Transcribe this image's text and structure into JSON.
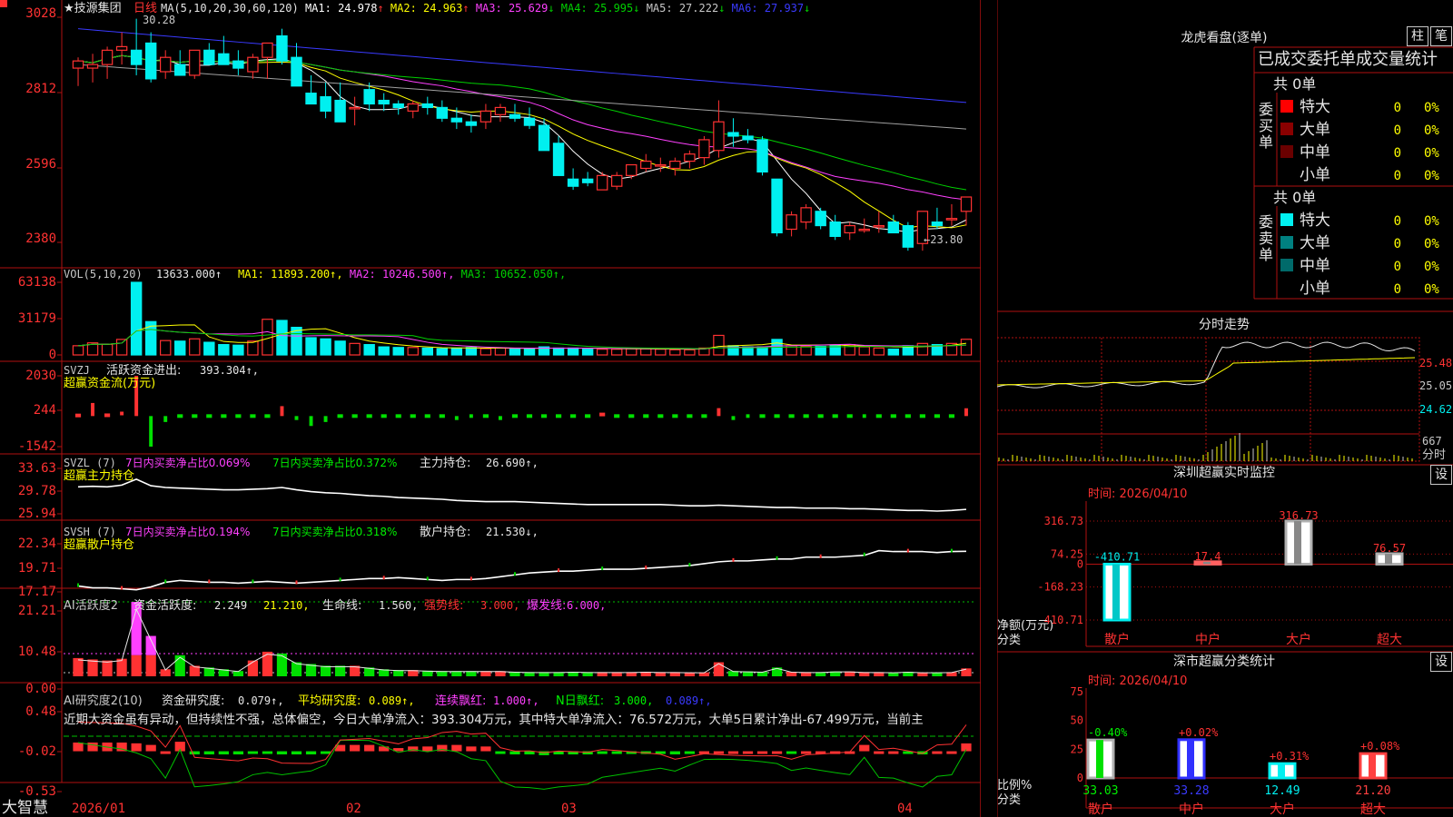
{
  "colors": {
    "up": "#ff3232",
    "down": "#00f0f0",
    "grid": "#b01010",
    "axis": "#ff3232",
    "white": "#ffffff",
    "yellow": "#ffff00",
    "magenta": "#ff40ff",
    "green": "#00d000",
    "blue": "#3a3aff",
    "gray": "#a0a0a0",
    "text": "#c8c8c8"
  },
  "main": {
    "title": "★技源集团",
    "period": "日线",
    "ma_label": "MA(5,10,20,30,60,120)",
    "ma_values": [
      {
        "label": "MA1:",
        "value": "24.978",
        "arrow": "↑",
        "color": "#ffffff"
      },
      {
        "label": "MA2:",
        "value": "24.963",
        "arrow": "↑",
        "color": "#ffff00"
      },
      {
        "label": "MA3:",
        "value": "25.629",
        "arrow": "↓",
        "color": "#ff40ff"
      },
      {
        "label": "MA4:",
        "value": "25.995",
        "arrow": "↓",
        "color": "#00d000"
      },
      {
        "label": "MA5:",
        "value": "27.222",
        "arrow": "↓",
        "color": "#c8c8c8"
      },
      {
        "label": "MA6:",
        "value": "27.937",
        "arrow": "↓",
        "color": "#3a3aff"
      }
    ],
    "y_ticks": [
      "3028",
      "2812",
      "2596",
      "2380"
    ],
    "high_label": "30.28",
    "low_label": "←23.80"
  },
  "vol": {
    "label": "VOL(5,10,20)",
    "value": "13633.000↑",
    "ma": [
      {
        "label": "MA1:",
        "value": "11893.200↑",
        "color": "#ffff00"
      },
      {
        "label": "MA2:",
        "value": "10246.500↑",
        "color": "#ff40ff"
      },
      {
        "label": "MA3:",
        "value": "10652.050↑",
        "color": "#00d000"
      }
    ],
    "y_ticks": [
      "63138",
      "31179",
      "0"
    ]
  },
  "svzj": {
    "label": "SVZJ",
    "text": "活跃资金进出:",
    "value": "393.304↑,",
    "sub": "超赢资金流(万元)",
    "y_ticks": [
      "2030",
      "244",
      "-1542"
    ]
  },
  "svzl": {
    "label": "SVZL (7)",
    "t1": "7日内买卖净占比0.069%",
    "t2": "7日内买卖净占比0.372%",
    "t3": "主力持仓:",
    "v3": "26.690↑,",
    "sub": "超赢主力持仓",
    "y_ticks": [
      "33.63",
      "29.78",
      "25.94"
    ]
  },
  "svsh": {
    "label": "SVSH (7)",
    "t1": "7日内买卖净占比0.194%",
    "t2": "7日内买卖净占比0.318%",
    "t3": "散户持仓:",
    "v3": "21.530↓,",
    "sub": "超赢散户持仓",
    "y_ticks": [
      "22.34",
      "19.71",
      "17.17"
    ]
  },
  "ai1": {
    "label": "AI活跃度2",
    "t1": "资金活跃度:",
    "v1": "2.249",
    "t2": "21.210,",
    "t3": "生命线:",
    "v3": "1.560,",
    "t4": "强势线:",
    "v4": "3.000,",
    "t5": "爆发线:",
    "v5": "6.000,",
    "y_ticks": [
      "21.21",
      "10.48",
      "0.00"
    ]
  },
  "ai2": {
    "label": "AI研究度2(10)",
    "t1": "资金研究度:",
    "v1": "0.079↑,",
    "t2": "平均研究度:",
    "v2": "0.089↑,",
    "t3": "连续飘红:",
    "v3": "1.000↑,",
    "t4": "N日飘红:",
    "v4": "3.000,",
    "v5": "0.089↑,",
    "commentary": "近期大资金虽有异动，但持续性不强，总体偏空，今日大单净流入：393.304万元，其中特大单净流入：76.572万元，大单5日累计净出-67.499万元，当前主",
    "y_ticks": [
      "0.48",
      "-0.02",
      "-0.53"
    ]
  },
  "x_axis": {
    "app": "大智慧",
    "labels": [
      "2026/01",
      "02",
      "03",
      "04"
    ]
  },
  "right": {
    "title": "龙虎看盘(逐单)",
    "btn1": "柱",
    "btn2": "笔",
    "subtitle": "已成交委托单成交量统计",
    "buy": {
      "side": "委买单",
      "total": "共 0单",
      "rows": [
        {
          "name": "特大",
          "v": "0",
          "p": "0%",
          "c": "#ff0000"
        },
        {
          "name": "大单",
          "v": "0",
          "p": "0%",
          "c": "#8a0000"
        },
        {
          "name": "中单",
          "v": "0",
          "p": "0%",
          "c": "#6a0000"
        },
        {
          "name": "小单",
          "v": "0",
          "p": "0%",
          "c": ""
        }
      ]
    },
    "sell": {
      "side": "委卖单",
      "total": "共 0单",
      "rows": [
        {
          "name": "特大",
          "v": "0",
          "p": "0%",
          "c": "#00f0f0"
        },
        {
          "name": "大单",
          "v": "0",
          "p": "0%",
          "c": "#008080"
        },
        {
          "name": "中单",
          "v": "0",
          "p": "0%",
          "c": "#006a6a"
        },
        {
          "name": "小单",
          "v": "0",
          "p": "0%",
          "c": ""
        }
      ]
    },
    "intraday": {
      "title": "分时走势",
      "ticks": [
        "25.48",
        "25.05",
        "24.62"
      ],
      "vol_tick": "667",
      "vol_label": "分时"
    },
    "monitor": {
      "title": "深圳超赢实时监控",
      "date": "时间: 2026/04/10",
      "btn": "设",
      "y_ticks": [
        "316.73",
        "74.25",
        "0",
        "-168.23",
        "-410.71"
      ],
      "ylabel1": "净额(万元)",
      "ylabel2": "分类",
      "bars": [
        {
          "cat": "散户",
          "label": "-410.71",
          "value": -410.71
        },
        {
          "cat": "中户",
          "label": "17.4",
          "value": 17.4
        },
        {
          "cat": "大户",
          "label": "316.73",
          "value": 316.73
        },
        {
          "cat": "超大",
          "label": "76.57",
          "value": 76.57
        }
      ]
    },
    "classify": {
      "title": "深市超赢分类统计",
      "date": "时间: 2026/04/10",
      "btn": "设",
      "y_ticks": [
        "75",
        "50",
        "25",
        "0"
      ],
      "ylabel1": "比例%",
      "ylabel2": "分类",
      "bars": [
        {
          "cat": "散户",
          "top": "-0.40%",
          "value": 33.03,
          "bottom": "33.03"
        },
        {
          "cat": "中户",
          "top": "+0.02%",
          "value": 33.28,
          "bottom": "33.28"
        },
        {
          "cat": "大户",
          "top": "+0.31%",
          "value": 12.49,
          "bottom": "12.49"
        },
        {
          "cat": "超大",
          "top": "+0.08%",
          "value": 21.2,
          "bottom": "21.20"
        }
      ]
    }
  },
  "chart_data": {
    "type": "candlestick",
    "price_ylim": [
      23.5,
      30.6
    ],
    "candles": [
      [
        28.9,
        29.2,
        28.4,
        29.1
      ],
      [
        28.9,
        29.3,
        28.5,
        29.0
      ],
      [
        29.0,
        29.5,
        28.6,
        29.4
      ],
      [
        29.4,
        29.9,
        29.0,
        29.5
      ],
      [
        29.4,
        30.28,
        28.7,
        29.0
      ],
      [
        29.6,
        29.9,
        28.5,
        28.6
      ],
      [
        28.8,
        29.4,
        28.6,
        29.2
      ],
      [
        29.0,
        29.4,
        28.7,
        28.7
      ],
      [
        28.7,
        29.4,
        28.6,
        29.4
      ],
      [
        29.4,
        29.6,
        29.0,
        29.0
      ],
      [
        29.3,
        29.8,
        29.0,
        29.0
      ],
      [
        29.1,
        29.4,
        28.7,
        28.9
      ],
      [
        28.8,
        29.3,
        28.6,
        29.2
      ],
      [
        29.2,
        29.6,
        28.6,
        29.6
      ],
      [
        29.8,
        30.0,
        29.0,
        29.1
      ],
      [
        29.2,
        29.6,
        28.4,
        28.4
      ],
      [
        28.2,
        28.7,
        27.9,
        27.9
      ],
      [
        28.1,
        28.5,
        27.5,
        27.7
      ],
      [
        28.0,
        28.5,
        27.4,
        27.4
      ],
      [
        27.8,
        28.1,
        27.3,
        27.8
      ],
      [
        28.3,
        28.5,
        27.7,
        27.9
      ],
      [
        28.0,
        28.2,
        27.7,
        27.9
      ],
      [
        27.9,
        28.0,
        27.6,
        27.8
      ],
      [
        27.7,
        28.0,
        27.5,
        27.9
      ],
      [
        27.9,
        28.1,
        27.6,
        27.8
      ],
      [
        27.8,
        28.0,
        27.4,
        27.5
      ],
      [
        27.5,
        27.8,
        27.2,
        27.4
      ],
      [
        27.4,
        27.6,
        27.1,
        27.3
      ],
      [
        27.4,
        27.9,
        27.2,
        27.7
      ],
      [
        27.6,
        27.9,
        27.4,
        27.8
      ],
      [
        27.6,
        27.9,
        27.4,
        27.5
      ],
      [
        27.5,
        27.8,
        27.2,
        27.3
      ],
      [
        27.3,
        27.5,
        26.6,
        26.6
      ],
      [
        26.8,
        27.0,
        25.9,
        25.9
      ],
      [
        25.8,
        26.1,
        25.5,
        25.6
      ],
      [
        25.8,
        26.0,
        25.6,
        25.7
      ],
      [
        25.5,
        26.0,
        25.5,
        25.9
      ],
      [
        25.6,
        26.0,
        25.5,
        25.9
      ],
      [
        25.9,
        26.2,
        25.8,
        26.2
      ],
      [
        26.1,
        26.5,
        26.0,
        26.3
      ],
      [
        26.2,
        26.4,
        26.0,
        26.2
      ],
      [
        26.1,
        26.4,
        25.9,
        26.3
      ],
      [
        26.3,
        26.6,
        26.1,
        26.5
      ],
      [
        26.4,
        27.0,
        26.2,
        26.9
      ],
      [
        26.6,
        28.0,
        26.4,
        27.4
      ],
      [
        27.1,
        27.5,
        26.7,
        27.0
      ],
      [
        27.0,
        27.2,
        26.8,
        26.9
      ],
      [
        26.9,
        27.0,
        25.9,
        26.0
      ],
      [
        25.8,
        25.8,
        24.2,
        24.3
      ],
      [
        24.4,
        24.9,
        24.2,
        24.8
      ],
      [
        24.6,
        25.1,
        24.4,
        25.0
      ],
      [
        24.9,
        25.0,
        24.4,
        24.5
      ],
      [
        24.6,
        24.8,
        24.1,
        24.2
      ],
      [
        24.3,
        24.6,
        24.1,
        24.5
      ],
      [
        24.4,
        24.7,
        24.3,
        24.4
      ],
      [
        24.5,
        24.9,
        24.3,
        24.5
      ],
      [
        24.6,
        24.8,
        24.3,
        24.3
      ],
      [
        24.5,
        24.6,
        23.8,
        23.9
      ],
      [
        24.0,
        24.9,
        23.8,
        24.9
      ],
      [
        24.6,
        25.0,
        24.4,
        24.5
      ],
      [
        24.7,
        25.1,
        24.5,
        24.7
      ],
      [
        24.9,
        25.3,
        24.5,
        25.3
      ]
    ],
    "vol_ylim": [
      0,
      63138
    ],
    "volume": [
      8000,
      10500,
      9200,
      13500,
      63138,
      29000,
      12500,
      12000,
      14000,
      11000,
      9000,
      8500,
      12000,
      31000,
      30000,
      24000,
      15000,
      14000,
      12000,
      10000,
      9000,
      7000,
      6500,
      6500,
      6000,
      5500,
      6000,
      6500,
      5500,
      6000,
      5000,
      5500,
      7000,
      6000,
      6000,
      5000,
      5000,
      5000,
      5500,
      5500,
      5000,
      4500,
      4500,
      6000,
      17000,
      8000,
      7000,
      7000,
      13500,
      8000,
      7500,
      7500,
      8000,
      9000,
      7000,
      6000,
      5000,
      8000,
      10000,
      9000,
      10000,
      13633
    ],
    "svzj_ylim": [
      -1542,
      2030
    ],
    "svzj": [
      30,
      660,
      40,
      130,
      2030,
      -1542,
      -300,
      -80,
      -70,
      -60,
      -40,
      -50,
      -80,
      -80,
      500,
      -200,
      -500,
      -300,
      -50,
      -80,
      -60,
      -60,
      -60,
      -60,
      -60,
      -80,
      -200,
      -150,
      -100,
      -200,
      -100,
      -50,
      -50,
      -50,
      -50,
      -50,
      80,
      -100,
      -100,
      -80,
      -50,
      -50,
      -60,
      -60,
      400,
      -200,
      -150,
      -60,
      -60,
      -70,
      -60,
      -60,
      -60,
      -60,
      -150,
      -80,
      -100,
      -60,
      -60,
      -80,
      -60,
      393.304
    ],
    "svzl_ylim": [
      25.94,
      33.63
    ],
    "svzl": [
      30.5,
      30.6,
      30.5,
      30.8,
      31.8,
      30.7,
      30.4,
      30.3,
      30.2,
      30.1,
      30.0,
      30.0,
      30.1,
      30.2,
      30.4,
      30.0,
      29.7,
      29.5,
      29.4,
      29.2,
      29.0,
      28.9,
      28.7,
      28.6,
      28.5,
      28.4,
      28.2,
      28.1,
      28.0,
      28.0,
      28.0,
      27.9,
      27.8,
      27.7,
      27.6,
      27.5,
      27.5,
      27.5,
      27.5,
      27.5,
      27.5,
      27.4,
      27.3,
      27.3,
      27.4,
      27.3,
      27.2,
      27.1,
      27.0,
      27.0,
      26.9,
      26.9,
      26.9,
      26.8,
      26.8,
      26.7,
      26.6,
      26.5,
      26.5,
      26.4,
      26.5,
      26.69
    ],
    "svsh_ylim": [
      17.17,
      22.34
    ],
    "svsh": [
      17.8,
      17.6,
      17.6,
      17.5,
      17.4,
      17.7,
      18.2,
      18.4,
      18.3,
      18.2,
      18.2,
      18.1,
      18.2,
      18.3,
      18.2,
      18.1,
      18.2,
      18.3,
      18.4,
      18.5,
      18.6,
      18.6,
      18.7,
      18.6,
      18.5,
      18.4,
      18.5,
      18.5,
      18.6,
      18.8,
      19.0,
      19.2,
      19.3,
      19.4,
      19.4,
      19.5,
      19.6,
      19.6,
      19.6,
      19.7,
      19.8,
      19.9,
      20.0,
      20.2,
      20.4,
      20.5,
      20.5,
      20.6,
      20.7,
      20.7,
      20.9,
      20.9,
      20.9,
      21.0,
      21.1,
      21.6,
      21.5,
      21.5,
      21.5,
      21.4,
      21.5,
      21.53
    ],
    "ai1_ylim": [
      0,
      21.21
    ],
    "ai1": [
      5.2,
      4.8,
      4.5,
      5.0,
      21.21,
      11.5,
      2.0,
      6.0,
      3.0,
      2.5,
      2.0,
      1.5,
      4.5,
      7.0,
      6.5,
      4.0,
      3.5,
      3.0,
      3.0,
      3.0,
      2.5,
      2.0,
      1.8,
      1.8,
      1.6,
      1.5,
      1.5,
      1.5,
      1.5,
      1.5,
      1.3,
      1.2,
      1.2,
      1.2,
      1.3,
      1.2,
      1.2,
      1.2,
      1.2,
      1.3,
      1.2,
      1.2,
      1.1,
      1.1,
      4.0,
      1.5,
      1.4,
      1.3,
      2.5,
      1.3,
      1.2,
      1.2,
      1.4,
      1.4,
      1.2,
      1.2,
      1.0,
      1.3,
      1.1,
      1.1,
      1.2,
      2.249
    ],
    "ai2_ylim": [
      -0.53,
      0.48
    ],
    "ai2": [
      0.09,
      0.09,
      0.09,
      0.09,
      0.08,
      0.06,
      -0.02,
      0.1,
      -0.06,
      -0.06,
      -0.06,
      -0.06,
      -0.04,
      -0.04,
      -0.06,
      -0.06,
      -0.06,
      -0.04,
      0.06,
      0.06,
      0.06,
      0.04,
      0.02,
      0.04,
      0.04,
      0.06,
      0.06,
      0.04,
      0.04,
      -0.04,
      -0.06,
      -0.06,
      -0.07,
      -0.06,
      -0.06,
      -0.06,
      -0.04,
      -0.04,
      -0.04,
      -0.04,
      -0.04,
      -0.06,
      -0.04,
      -0.02,
      -0.02,
      -0.02,
      -0.02,
      -0.02,
      -0.02,
      -0.04,
      -0.02,
      -0.02,
      -0.02,
      -0.02,
      0.06,
      -0.02,
      -0.02,
      -0.04,
      -0.06,
      -0.02,
      -0.02,
      0.079
    ]
  }
}
